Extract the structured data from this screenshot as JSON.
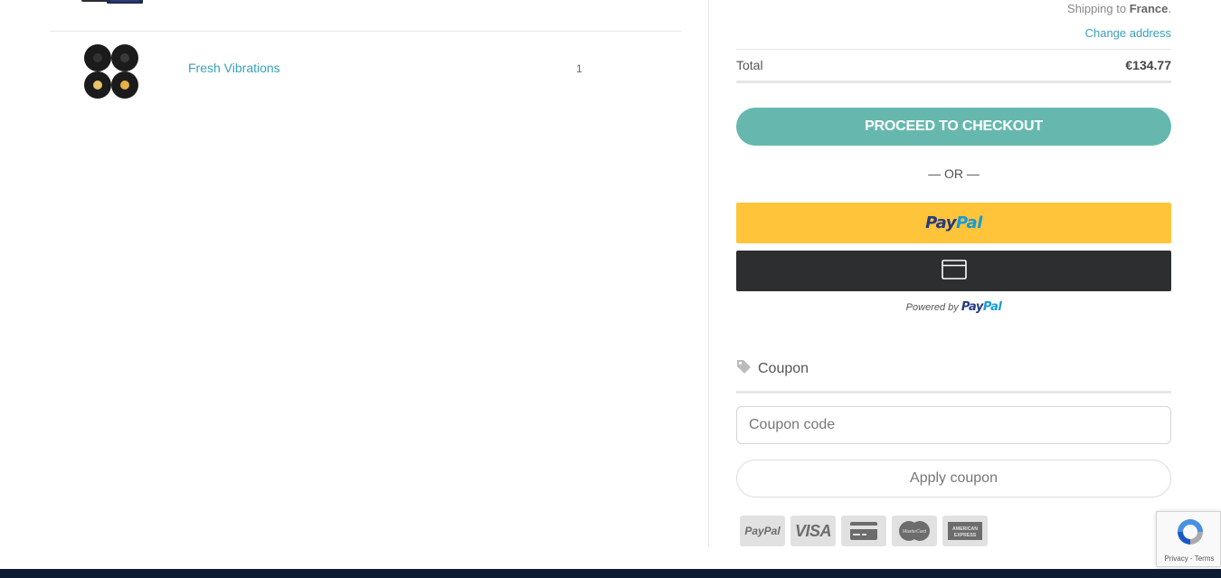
{
  "cart": {
    "items": [
      {
        "name": "",
        "qty": ""
      },
      {
        "name": "Fresh Vibrations",
        "qty": "1"
      }
    ]
  },
  "summary": {
    "shipping_prefix": "Shipping to",
    "shipping_country": "France",
    "shipping_suffix": ".",
    "change_address": "Change address",
    "total_label": "Total",
    "total_value": "€134.77",
    "checkout_label": "PROCEED TO CHECKOUT",
    "or_label": "— OR —",
    "paypal": {
      "logo_pay": "Pay",
      "logo_pal": "Pal",
      "powered_prefix": "Powered by"
    }
  },
  "coupon": {
    "title": "Coupon",
    "placeholder": "Coupon code",
    "value": "",
    "apply_label": "Apply coupon"
  },
  "payment_icons": [
    {
      "name": "paypal-icon",
      "label": "PayPal"
    },
    {
      "name": "visa-icon",
      "label": "VISA"
    },
    {
      "name": "credit-card-icon",
      "label": ""
    },
    {
      "name": "mastercard-icon",
      "label": "MasterCard"
    },
    {
      "name": "amex-icon",
      "label": "AMERICAN EXPRESS"
    }
  ],
  "recaptcha": {
    "links": "Privacy - Terms"
  },
  "colors": {
    "accent": "#66b8ae",
    "link": "#3aa0b8",
    "paypal_yellow": "#ffc439",
    "paypal_dark": "#2c2e2f",
    "footer": "#0d1b33"
  }
}
